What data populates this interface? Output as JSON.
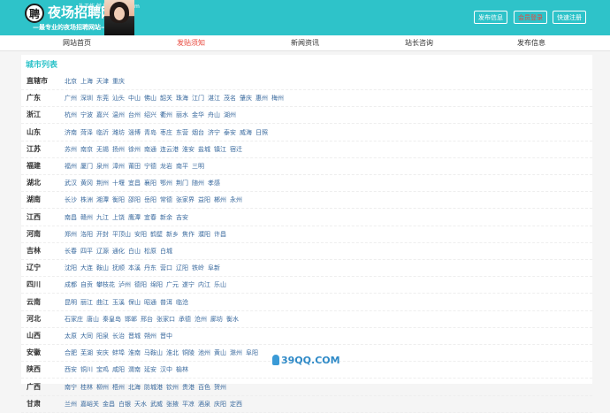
{
  "header": {
    "logo_char": "聘",
    "site_name": "夜场招聘网",
    "site_sub": "礼工作   就上1818zp.com",
    "slogan": "—最专业的夜场招聘网站—",
    "buttons": {
      "post": "发布信息",
      "login": "会员登录",
      "register": "快速注册"
    },
    "colors": {
      "bar": "#2ec3c9",
      "accent_red": "#e8473c"
    }
  },
  "nav": {
    "items": [
      {
        "label": "网站首页"
      },
      {
        "label": "发贴须知"
      },
      {
        "label": "新闻资讯"
      },
      {
        "label": "站长咨询"
      },
      {
        "label": "发布信息"
      }
    ]
  },
  "section": {
    "title": "城市列表"
  },
  "provinces": [
    {
      "name": "直辖市",
      "cities": [
        "北京",
        "上海",
        "天津",
        "重庆"
      ]
    },
    {
      "name": "广东",
      "cities": [
        "广州",
        "深圳",
        "东莞",
        "汕头",
        "中山",
        "佛山",
        "韶关",
        "珠海",
        "江门",
        "湛江",
        "茂名",
        "肇庆",
        "惠州",
        "梅州"
      ]
    },
    {
      "name": "浙江",
      "cities": [
        "杭州",
        "宁波",
        "嘉兴",
        "温州",
        "台州",
        "绍兴",
        "衢州",
        "丽水",
        "金华",
        "舟山",
        "湖州"
      ]
    },
    {
      "name": "山东",
      "cities": [
        "济南",
        "菏泽",
        "临沂",
        "潍坊",
        "淄博",
        "青岛",
        "枣庄",
        "东营",
        "烟台",
        "济宁",
        "泰安",
        "威海",
        "日照"
      ]
    },
    {
      "name": "江苏",
      "cities": [
        "苏州",
        "南京",
        "无锡",
        "扬州",
        "徐州",
        "南通",
        "连云港",
        "淮安",
        "盐城",
        "镇江",
        "宿迁"
      ]
    },
    {
      "name": "福建",
      "cities": [
        "福州",
        "厦门",
        "泉州",
        "漳州",
        "莆田",
        "宁德",
        "龙岩",
        "南平",
        "三明"
      ]
    },
    {
      "name": "湖北",
      "cities": [
        "武汉",
        "黄冈",
        "荆州",
        "十堰",
        "宜昌",
        "襄阳",
        "鄂州",
        "荆门",
        "随州",
        "孝感"
      ]
    },
    {
      "name": "湖南",
      "cities": [
        "长沙",
        "株洲",
        "湘潭",
        "衡阳",
        "邵阳",
        "岳阳",
        "常德",
        "张家界",
        "益阳",
        "郴州",
        "永州"
      ]
    },
    {
      "name": "江西",
      "cities": [
        "南昌",
        "赣州",
        "九江",
        "上饶",
        "鹰潭",
        "宜春",
        "新余",
        "吉安"
      ]
    },
    {
      "name": "河南",
      "cities": [
        "郑州",
        "洛阳",
        "开封",
        "平顶山",
        "安阳",
        "鹤壁",
        "新乡",
        "焦作",
        "濮阳",
        "许昌"
      ]
    },
    {
      "name": "吉林",
      "cities": [
        "长春",
        "四平",
        "辽源",
        "通化",
        "白山",
        "松原",
        "白城"
      ]
    },
    {
      "name": "辽宁",
      "cities": [
        "沈阳",
        "大连",
        "鞍山",
        "抚顺",
        "本溪",
        "丹东",
        "营口",
        "辽阳",
        "铁岭",
        "阜新"
      ]
    },
    {
      "name": "四川",
      "cities": [
        "成都",
        "自贡",
        "攀枝花",
        "泸州",
        "德阳",
        "绵阳",
        "广元",
        "遂宁",
        "内江",
        "乐山"
      ]
    },
    {
      "name": "云南",
      "cities": [
        "昆明",
        "丽江",
        "曲江",
        "玉溪",
        "保山",
        "昭通",
        "普洱",
        "临沧"
      ]
    },
    {
      "name": "河北",
      "cities": [
        "石家庄",
        "唐山",
        "秦皇岛",
        "邯郸",
        "邢台",
        "张家口",
        "承德",
        "沧州",
        "廊坊",
        "衡水"
      ]
    },
    {
      "name": "山西",
      "cities": [
        "太原",
        "大同",
        "阳泉",
        "长治",
        "晋城",
        "朔州",
        "晋中"
      ]
    },
    {
      "name": "安徽",
      "cities": [
        "合肥",
        "芜湖",
        "安庆",
        "蚌埠",
        "淮南",
        "马鞍山",
        "淮北",
        "铜陵",
        "池州",
        "黄山",
        "滁州",
        "阜阳"
      ]
    },
    {
      "name": "陕西",
      "cities": [
        "西安",
        "铜川",
        "宝鸡",
        "咸阳",
        "渭南",
        "延安",
        "汉中",
        "榆林"
      ]
    },
    {
      "name": "广西",
      "cities": [
        "南宁",
        "桂林",
        "柳州",
        "梧州",
        "北海",
        "防城港",
        "钦州",
        "贵港",
        "百色",
        "贺州"
      ]
    },
    {
      "name": "甘肃",
      "cities": [
        "兰州",
        "嘉峪关",
        "金昌",
        "白银",
        "天水",
        "武威",
        "张掖",
        "平凉",
        "酒泉",
        "庆阳",
        "定西"
      ]
    }
  ],
  "watermark": "39QQ.COM"
}
